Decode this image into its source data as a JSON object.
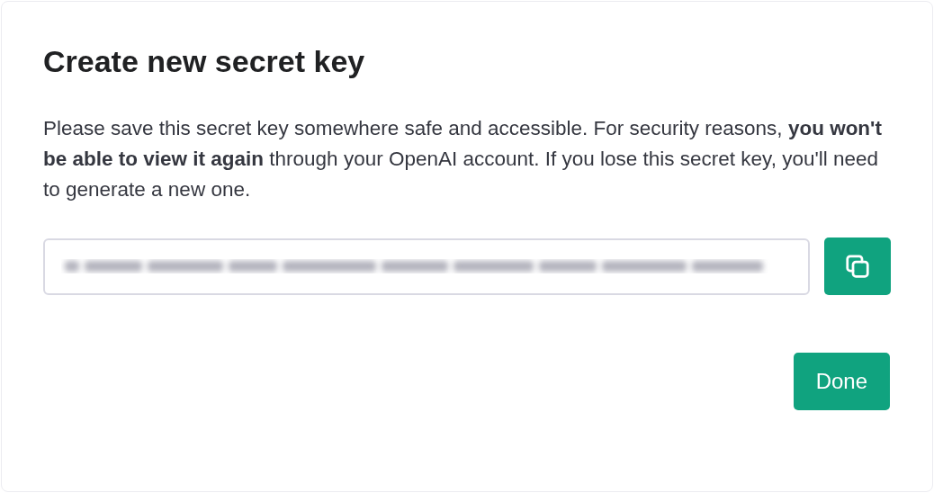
{
  "dialog": {
    "title": "Create new secret key",
    "message": "Please save this secret key somewhere safe and accessible. For security reasons, **you won't be able to view it again** through your OpenAI account. If you lose this secret key, you'll need to generate a new one.",
    "key_field": {
      "blurred": true
    },
    "buttons": [
      {
        "kind": "copy"
      },
      {
        "kind": "primary",
        "label": "Done"
      }
    ]
  }
}
